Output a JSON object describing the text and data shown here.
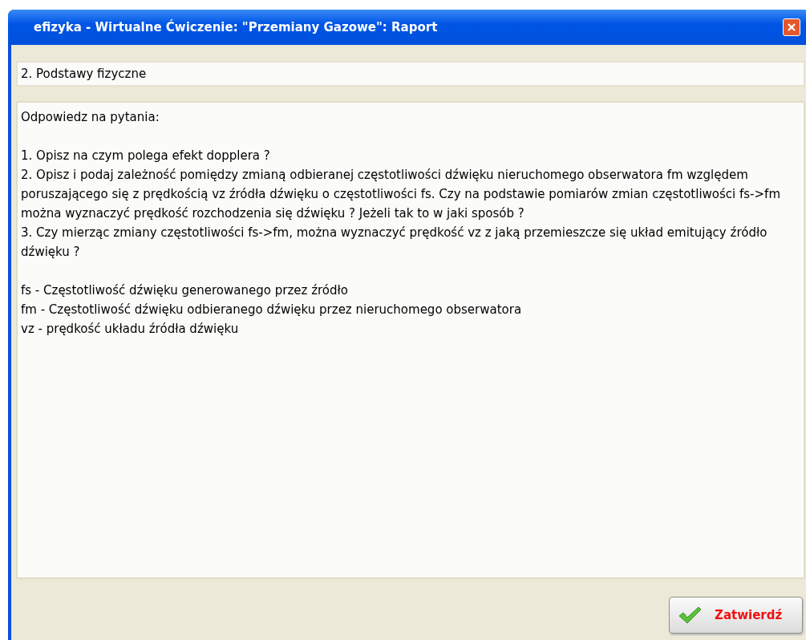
{
  "window": {
    "title": "efizyka - Wirtualne Ćwiczenie: \"Przemiany Gazowe\": Raport"
  },
  "section_field": {
    "value": "2. Podstawy fizyczne"
  },
  "report_text": {
    "blocks": [
      [
        "Odpowiedz na pytania:"
      ],
      [
        "1. Opisz na czym polega efekt dopplera ?",
        "2. Opisz i podaj zależność pomiędzy zmianą odbieranej częstotliwości dźwięku nieruchomego obserwatora fm względem poruszającego się z prędkością vz źródła dźwięku o częstotliwości fs. Czy na podstawie pomiarów zmian częstotliwości fs->fm można wyznaczyć prędkość rozchodzenia się dźwięku ? Jeżeli tak to w jaki sposób ?",
        "3. Czy mierząc zmiany częstotliwości fs->fm, można wyznaczyć prędkość vz z jaką przemieszcze się układ emitujący źródło dźwięku ?"
      ],
      [
        "fs - Częstotliwość dźwięku generowanego przez źródło",
        "fm - Częstotliwość dźwięku odbieranego dźwięku przez nieruchomego obserwatora",
        "vz - prędkość układu źródła dźwięku"
      ]
    ]
  },
  "confirm_button": {
    "label": "Zatwierdź"
  }
}
